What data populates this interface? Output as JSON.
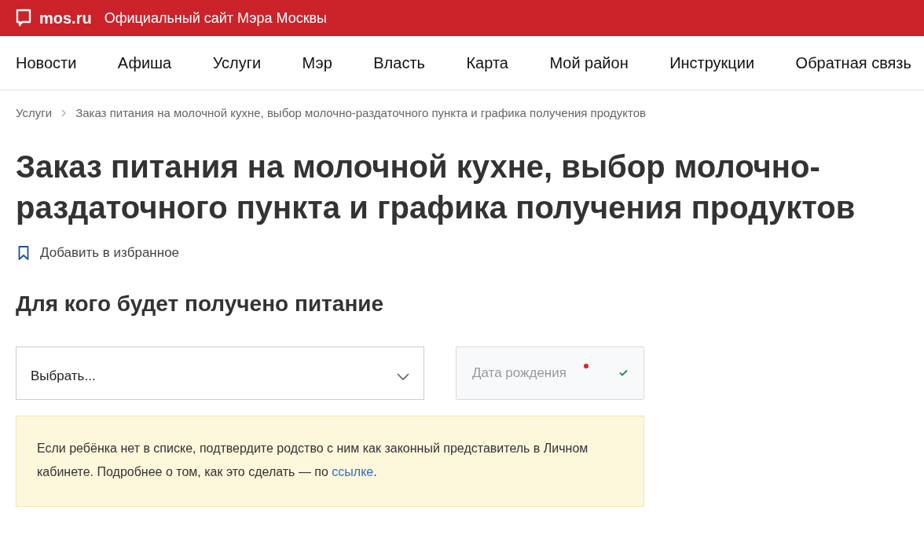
{
  "header": {
    "logo": "mos.ru",
    "tagline": "Официальный сайт Мэра Москвы"
  },
  "nav": [
    "Новости",
    "Афиша",
    "Услуги",
    "Мэр",
    "Власть",
    "Карта",
    "Мой район",
    "Инструкции",
    "Обратная связь"
  ],
  "breadcrumbs": [
    "Услуги",
    "Заказ питания на молочной кухне, выбор молочно-раздаточного пункта и графика получения продуктов"
  ],
  "title": "Заказ питания на молочной кухне, выбор молочно-раздаточного пункта и графика получения продуктов",
  "favorite": {
    "label": "Добавить в избранное"
  },
  "section_title": "Для кого будет получено питание",
  "select": {
    "value": "Выбрать..."
  },
  "date_field": {
    "placeholder": "Дата рождения",
    "required": true,
    "valid": true
  },
  "notice": {
    "text": "Если ребёнка нет в списке, подтвердите родство с ним как законный представитель в Личном кабинете. Подробнее о том, как это сделать — по ",
    "link": "ссылке",
    "text_after": "."
  }
}
